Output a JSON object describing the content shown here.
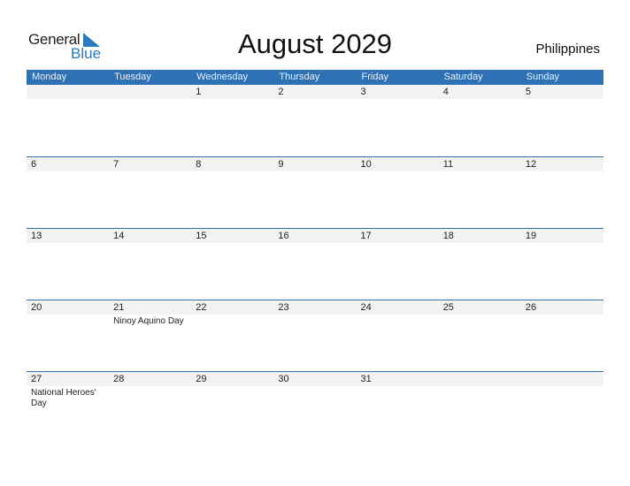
{
  "logo": {
    "general": "General",
    "blue": "Blue",
    "icon": "logo-triangle-icon",
    "accent": "#2a7ac0"
  },
  "title": "August 2029",
  "country": "Philippines",
  "colors": {
    "header_bg": "#2e72b5",
    "date_row_bg": "#f2f2f2"
  },
  "weekdays": [
    "Monday",
    "Tuesday",
    "Wednesday",
    "Thursday",
    "Friday",
    "Saturday",
    "Sunday"
  ],
  "weeks": [
    {
      "days": [
        {
          "num": "",
          "event": ""
        },
        {
          "num": "",
          "event": ""
        },
        {
          "num": "1",
          "event": ""
        },
        {
          "num": "2",
          "event": ""
        },
        {
          "num": "3",
          "event": ""
        },
        {
          "num": "4",
          "event": ""
        },
        {
          "num": "5",
          "event": ""
        }
      ]
    },
    {
      "days": [
        {
          "num": "6",
          "event": ""
        },
        {
          "num": "7",
          "event": ""
        },
        {
          "num": "8",
          "event": ""
        },
        {
          "num": "9",
          "event": ""
        },
        {
          "num": "10",
          "event": ""
        },
        {
          "num": "11",
          "event": ""
        },
        {
          "num": "12",
          "event": ""
        }
      ]
    },
    {
      "days": [
        {
          "num": "13",
          "event": ""
        },
        {
          "num": "14",
          "event": ""
        },
        {
          "num": "15",
          "event": ""
        },
        {
          "num": "16",
          "event": ""
        },
        {
          "num": "17",
          "event": ""
        },
        {
          "num": "18",
          "event": ""
        },
        {
          "num": "19",
          "event": ""
        }
      ]
    },
    {
      "days": [
        {
          "num": "20",
          "event": ""
        },
        {
          "num": "21",
          "event": "Ninoy Aquino Day"
        },
        {
          "num": "22",
          "event": ""
        },
        {
          "num": "23",
          "event": ""
        },
        {
          "num": "24",
          "event": ""
        },
        {
          "num": "25",
          "event": ""
        },
        {
          "num": "26",
          "event": ""
        }
      ]
    },
    {
      "days": [
        {
          "num": "27",
          "event": "National Heroes' Day"
        },
        {
          "num": "28",
          "event": ""
        },
        {
          "num": "29",
          "event": ""
        },
        {
          "num": "30",
          "event": ""
        },
        {
          "num": "31",
          "event": ""
        },
        {
          "num": "",
          "event": ""
        },
        {
          "num": "",
          "event": ""
        }
      ]
    }
  ]
}
